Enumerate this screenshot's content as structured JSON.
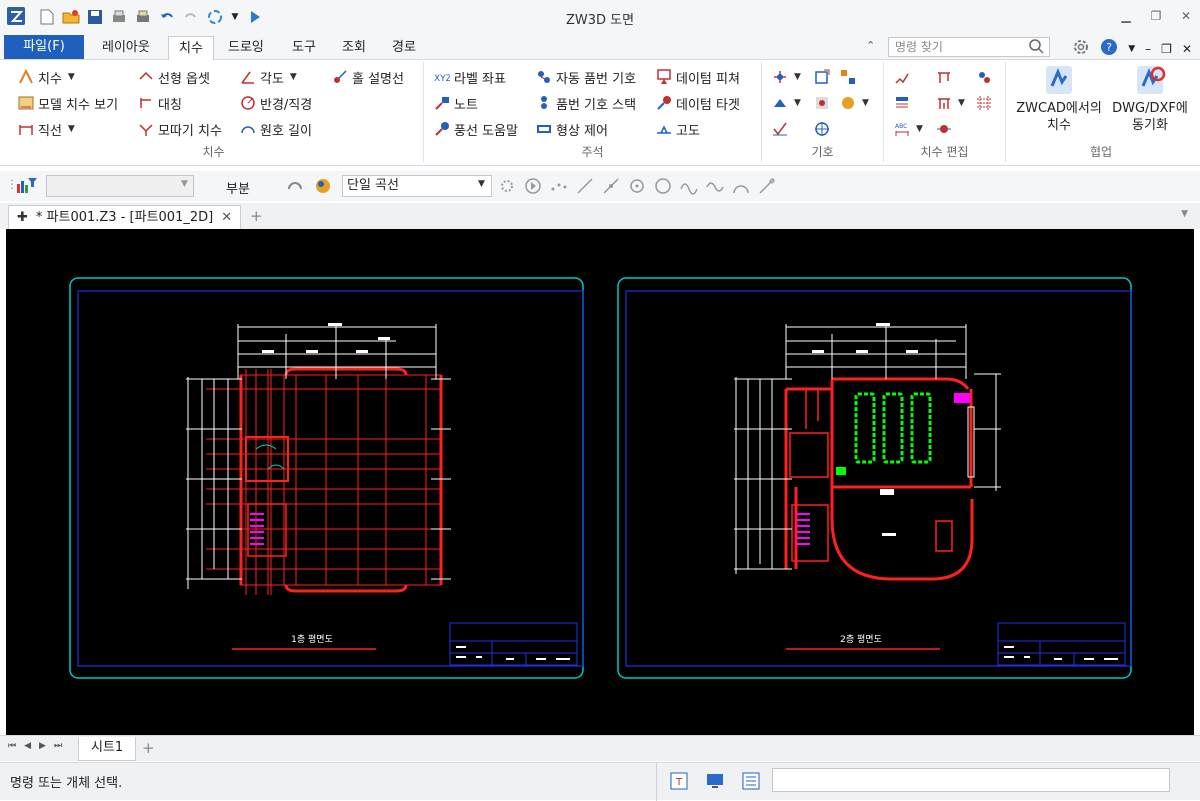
{
  "app": {
    "title": "ZW3D 도면"
  },
  "menu_tabs": [
    "파일(F)",
    "레이아웃",
    "치수",
    "드로잉",
    "도구",
    "조회",
    "경로"
  ],
  "search": {
    "placeholder": "명령 찾기"
  },
  "ribbon": {
    "dimension": {
      "label": "치수",
      "items": [
        "치수",
        "모델 치수 보기",
        "직선",
        "선형 옵셋",
        "대칭",
        "모따기 치수",
        "각도",
        "반경/직경",
        "원호 길이",
        "홀 설명선"
      ]
    },
    "annotation": {
      "label": "주석",
      "items": [
        "라벨 좌표",
        "노트",
        "풍선 도움말",
        "자동 품번 기호",
        "품번 기호 스택",
        "형상 제어",
        "데이텀 피쳐",
        "데이텀 타겟",
        "고도"
      ]
    },
    "symbol": {
      "label": "기호"
    },
    "dim_edit": {
      "label": "치수 편집"
    },
    "collab": {
      "label": "협업",
      "zwcad": "ZWCAD에서의\n치수",
      "dwg": "DWG/DXF에\n동기화"
    }
  },
  "toolbar2": {
    "filter_value": "",
    "partial_label": "부분",
    "curve_mode": "단일 곡선"
  },
  "document_tab": {
    "title": "* 파트001.Z3 - [파트001_2D]"
  },
  "drawings": {
    "left_title": "1층 평면도",
    "right_title": "2층 평면도"
  },
  "sheet": {
    "tab": "시트1"
  },
  "status": {
    "prompt": "명령 또는 개체 선택.",
    "input_value": ""
  },
  "colors": {
    "file_tab": "#1f5fbd",
    "canvas": "#000000",
    "frame": "#00c8c8",
    "border": "#2030e0",
    "wall": "#ff2020",
    "dim": "#ffffff",
    "stairs": "#ff00ff",
    "seats": "#00ff00"
  }
}
